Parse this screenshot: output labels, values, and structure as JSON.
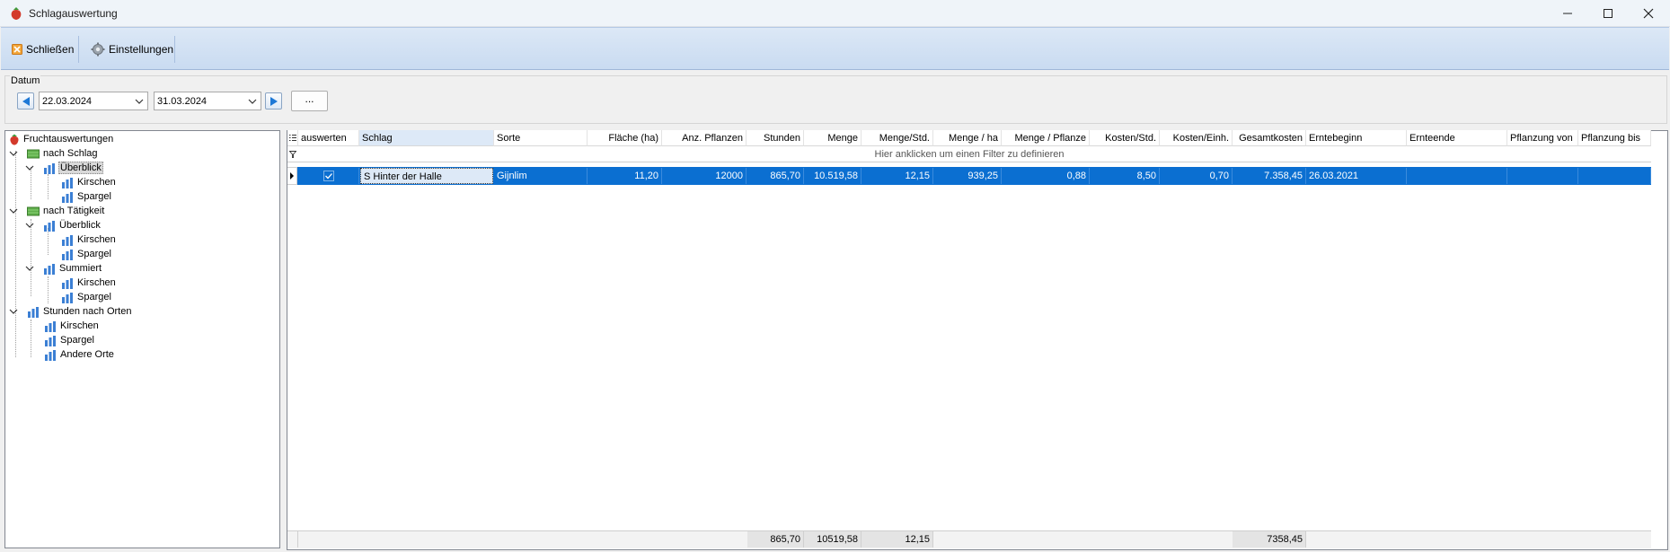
{
  "window": {
    "title": "Schlagauswertung",
    "icon": "strawberry-icon"
  },
  "toolbar": {
    "close_label": "Schließen",
    "settings_label": "Einstellungen"
  },
  "datum": {
    "group_label": "Datum",
    "from": "22.03.2024",
    "to": "31.03.2024",
    "more_label": "..."
  },
  "tree": {
    "root": "Fruchtauswertungen",
    "nach_schlag": {
      "label": "nach Schlag",
      "overview": "Überblick",
      "items": [
        "Kirschen",
        "Spargel"
      ]
    },
    "nach_taetigkeit": {
      "label": "nach Tätigkeit",
      "overview": "Überblick",
      "overview_items": [
        "Kirschen",
        "Spargel"
      ],
      "summed": "Summiert",
      "summed_items": [
        "Kirschen",
        "Spargel"
      ]
    },
    "stunden_nach_orten": {
      "label": "Stunden nach Orten",
      "items": [
        "Kirschen",
        "Spargel",
        "Andere Orte"
      ]
    }
  },
  "grid": {
    "columns": [
      "auswerten",
      "Schlag",
      "Sorte",
      "Fläche (ha)",
      "Anz. Pflanzen",
      "Stunden",
      "Menge",
      "Menge/Std.",
      "Menge / ha",
      "Menge / Pflanze",
      "Kosten/Std.",
      "Kosten/Einh.",
      "Gesamtkosten",
      "Erntebeginn",
      "Ernteende",
      "Pflanzung von",
      "Pflanzung bis"
    ],
    "filter_hint": "Hier anklicken um einen Filter zu definieren",
    "rows": [
      {
        "auswerten": true,
        "schlag": "S Hinter der Halle",
        "sorte": "Gijnlim",
        "flaeche": "11,20",
        "anz_pflanzen": "12000",
        "stunden": "865,70",
        "menge": "10.519,58",
        "menge_std": "12,15",
        "menge_ha": "939,25",
        "menge_pflanze": "0,88",
        "kosten_std": "8,50",
        "kosten_einh": "0,70",
        "gesamtkosten": "7.358,45",
        "erntebeginn": "26.03.2021",
        "ernteende": "",
        "pflanzung_von": "",
        "pflanzung_bis": ""
      }
    ],
    "footer": {
      "stunden": "865,70",
      "menge": "10519,58",
      "menge_std": "12,15",
      "gesamtkosten": "7358,45"
    }
  },
  "colors": {
    "selection": "#0b6fd1",
    "toolbar_top": "#dce8f6",
    "toolbar_bottom": "#c9dbf1"
  }
}
